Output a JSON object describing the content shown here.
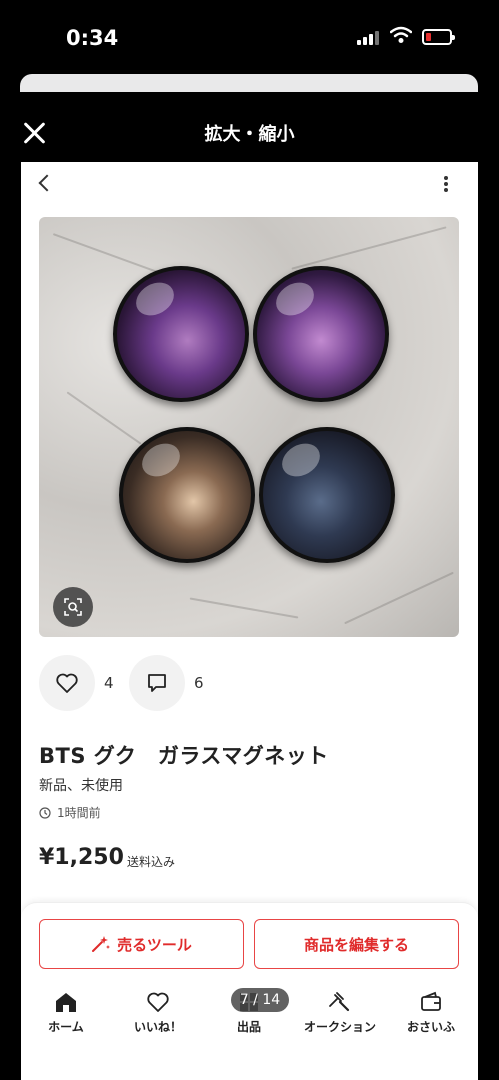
{
  "status_bar": {
    "time": "0:34",
    "battery_color": "#e53030"
  },
  "modal": {
    "title": "拡大・縮小"
  },
  "item": {
    "likes": "4",
    "comments": "6",
    "title": "BTS グク　ガラスマグネット",
    "condition": "新品、未使用",
    "posted": "1時間前",
    "price": "¥1,250",
    "price_note": "送料込み"
  },
  "actions": {
    "sell_tool": "売るツール",
    "edit_item": "商品を編集する"
  },
  "tabbar": {
    "home": "ホーム",
    "likes": "いいね！",
    "sell": "出品",
    "auction": "オークション",
    "wallet": "おさいふ"
  },
  "page_counter": "7 / 14",
  "colors": {
    "accent": "#e84545"
  }
}
